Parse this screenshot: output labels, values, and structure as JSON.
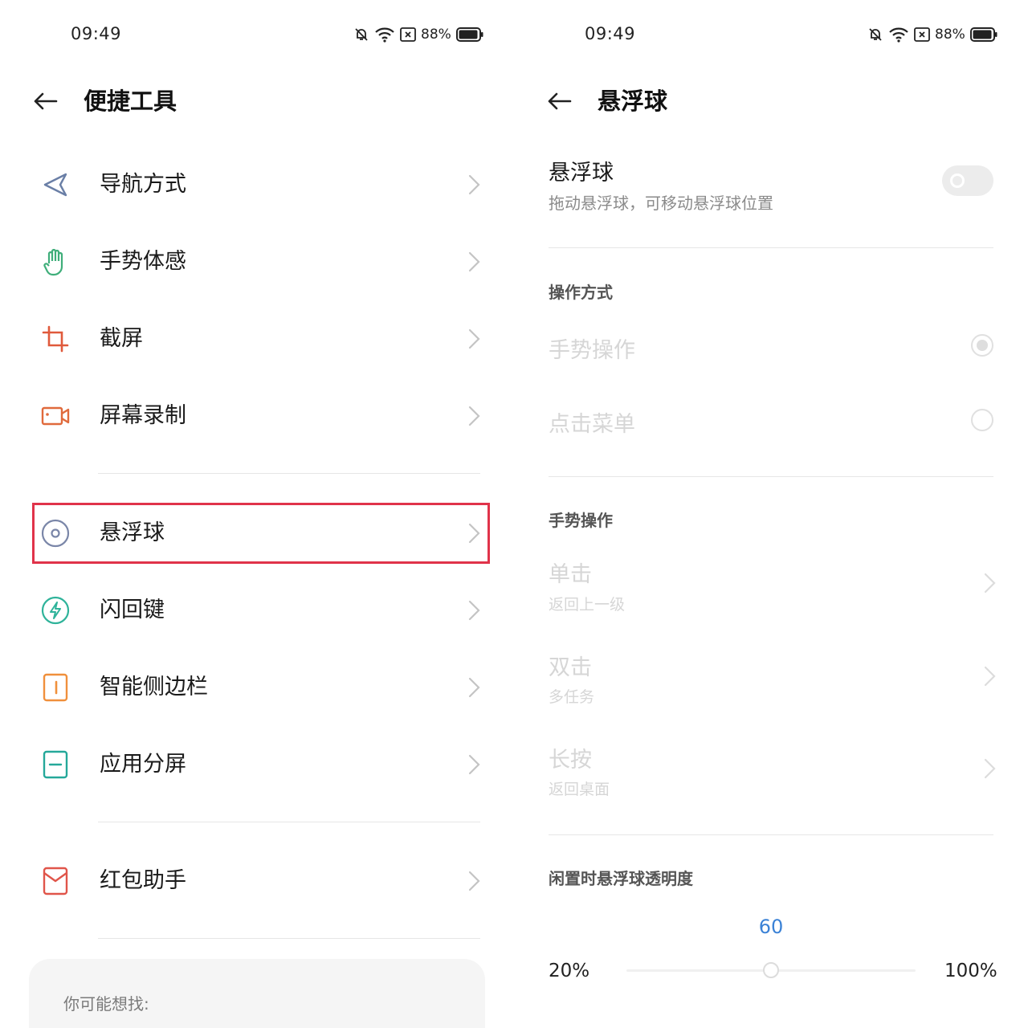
{
  "left": {
    "status": {
      "time": "09:49",
      "battery": "88%"
    },
    "title": "便捷工具",
    "items": [
      {
        "label": "导航方式",
        "icon": "navigation-arrow-icon"
      },
      {
        "label": "手势体感",
        "icon": "hand-gesture-icon"
      },
      {
        "label": "截屏",
        "icon": "crop-icon"
      },
      {
        "label": "屏幕录制",
        "icon": "video-record-icon"
      },
      {
        "label": "悬浮球",
        "icon": "floating-ball-icon"
      },
      {
        "label": "闪回键",
        "icon": "flash-back-icon"
      },
      {
        "label": "智能侧边栏",
        "icon": "sidebar-icon"
      },
      {
        "label": "应用分屏",
        "icon": "split-screen-icon"
      },
      {
        "label": "红包助手",
        "icon": "red-envelope-icon"
      }
    ],
    "suggest_title": "你可能想找:"
  },
  "right": {
    "status": {
      "time": "09:49",
      "battery": "88%"
    },
    "title": "悬浮球",
    "toggle": {
      "title": "悬浮球",
      "subtitle": "拖动悬浮球，可移动悬浮球位置",
      "on": false
    },
    "mode_section": "操作方式",
    "modes": [
      {
        "label": "手势操作",
        "selected": true
      },
      {
        "label": "点击菜单",
        "selected": false
      }
    ],
    "gesture_section": "手势操作",
    "gestures": [
      {
        "title": "单击",
        "subtitle": "返回上一级"
      },
      {
        "title": "双击",
        "subtitle": "多任务"
      },
      {
        "title": "长按",
        "subtitle": "返回桌面"
      }
    ],
    "opacity": {
      "title": "闲置时悬浮球透明度",
      "value": "60",
      "min_label": "20%",
      "max_label": "100%",
      "min": 20,
      "max": 100,
      "current": 60
    }
  },
  "colors": {
    "accent": "#3b82d6",
    "highlight": "#e0334a"
  }
}
